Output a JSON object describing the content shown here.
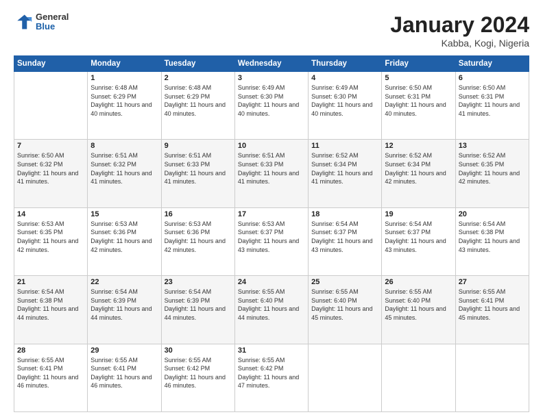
{
  "header": {
    "logo": {
      "general": "General",
      "blue": "Blue"
    },
    "title": "January 2024",
    "location": "Kabba, Kogi, Nigeria"
  },
  "calendar": {
    "headers": [
      "Sunday",
      "Monday",
      "Tuesday",
      "Wednesday",
      "Thursday",
      "Friday",
      "Saturday"
    ],
    "weeks": [
      [
        {
          "day": "",
          "sunrise": "",
          "sunset": "",
          "daylight": ""
        },
        {
          "day": "1",
          "sunrise": "Sunrise: 6:48 AM",
          "sunset": "Sunset: 6:29 PM",
          "daylight": "Daylight: 11 hours and 40 minutes."
        },
        {
          "day": "2",
          "sunrise": "Sunrise: 6:48 AM",
          "sunset": "Sunset: 6:29 PM",
          "daylight": "Daylight: 11 hours and 40 minutes."
        },
        {
          "day": "3",
          "sunrise": "Sunrise: 6:49 AM",
          "sunset": "Sunset: 6:30 PM",
          "daylight": "Daylight: 11 hours and 40 minutes."
        },
        {
          "day": "4",
          "sunrise": "Sunrise: 6:49 AM",
          "sunset": "Sunset: 6:30 PM",
          "daylight": "Daylight: 11 hours and 40 minutes."
        },
        {
          "day": "5",
          "sunrise": "Sunrise: 6:50 AM",
          "sunset": "Sunset: 6:31 PM",
          "daylight": "Daylight: 11 hours and 40 minutes."
        },
        {
          "day": "6",
          "sunrise": "Sunrise: 6:50 AM",
          "sunset": "Sunset: 6:31 PM",
          "daylight": "Daylight: 11 hours and 41 minutes."
        }
      ],
      [
        {
          "day": "7",
          "sunrise": "Sunrise: 6:50 AM",
          "sunset": "Sunset: 6:32 PM",
          "daylight": "Daylight: 11 hours and 41 minutes."
        },
        {
          "day": "8",
          "sunrise": "Sunrise: 6:51 AM",
          "sunset": "Sunset: 6:32 PM",
          "daylight": "Daylight: 11 hours and 41 minutes."
        },
        {
          "day": "9",
          "sunrise": "Sunrise: 6:51 AM",
          "sunset": "Sunset: 6:33 PM",
          "daylight": "Daylight: 11 hours and 41 minutes."
        },
        {
          "day": "10",
          "sunrise": "Sunrise: 6:51 AM",
          "sunset": "Sunset: 6:33 PM",
          "daylight": "Daylight: 11 hours and 41 minutes."
        },
        {
          "day": "11",
          "sunrise": "Sunrise: 6:52 AM",
          "sunset": "Sunset: 6:34 PM",
          "daylight": "Daylight: 11 hours and 41 minutes."
        },
        {
          "day": "12",
          "sunrise": "Sunrise: 6:52 AM",
          "sunset": "Sunset: 6:34 PM",
          "daylight": "Daylight: 11 hours and 42 minutes."
        },
        {
          "day": "13",
          "sunrise": "Sunrise: 6:52 AM",
          "sunset": "Sunset: 6:35 PM",
          "daylight": "Daylight: 11 hours and 42 minutes."
        }
      ],
      [
        {
          "day": "14",
          "sunrise": "Sunrise: 6:53 AM",
          "sunset": "Sunset: 6:35 PM",
          "daylight": "Daylight: 11 hours and 42 minutes."
        },
        {
          "day": "15",
          "sunrise": "Sunrise: 6:53 AM",
          "sunset": "Sunset: 6:36 PM",
          "daylight": "Daylight: 11 hours and 42 minutes."
        },
        {
          "day": "16",
          "sunrise": "Sunrise: 6:53 AM",
          "sunset": "Sunset: 6:36 PM",
          "daylight": "Daylight: 11 hours and 42 minutes."
        },
        {
          "day": "17",
          "sunrise": "Sunrise: 6:53 AM",
          "sunset": "Sunset: 6:37 PM",
          "daylight": "Daylight: 11 hours and 43 minutes."
        },
        {
          "day": "18",
          "sunrise": "Sunrise: 6:54 AM",
          "sunset": "Sunset: 6:37 PM",
          "daylight": "Daylight: 11 hours and 43 minutes."
        },
        {
          "day": "19",
          "sunrise": "Sunrise: 6:54 AM",
          "sunset": "Sunset: 6:37 PM",
          "daylight": "Daylight: 11 hours and 43 minutes."
        },
        {
          "day": "20",
          "sunrise": "Sunrise: 6:54 AM",
          "sunset": "Sunset: 6:38 PM",
          "daylight": "Daylight: 11 hours and 43 minutes."
        }
      ],
      [
        {
          "day": "21",
          "sunrise": "Sunrise: 6:54 AM",
          "sunset": "Sunset: 6:38 PM",
          "daylight": "Daylight: 11 hours and 44 minutes."
        },
        {
          "day": "22",
          "sunrise": "Sunrise: 6:54 AM",
          "sunset": "Sunset: 6:39 PM",
          "daylight": "Daylight: 11 hours and 44 minutes."
        },
        {
          "day": "23",
          "sunrise": "Sunrise: 6:54 AM",
          "sunset": "Sunset: 6:39 PM",
          "daylight": "Daylight: 11 hours and 44 minutes."
        },
        {
          "day": "24",
          "sunrise": "Sunrise: 6:55 AM",
          "sunset": "Sunset: 6:40 PM",
          "daylight": "Daylight: 11 hours and 44 minutes."
        },
        {
          "day": "25",
          "sunrise": "Sunrise: 6:55 AM",
          "sunset": "Sunset: 6:40 PM",
          "daylight": "Daylight: 11 hours and 45 minutes."
        },
        {
          "day": "26",
          "sunrise": "Sunrise: 6:55 AM",
          "sunset": "Sunset: 6:40 PM",
          "daylight": "Daylight: 11 hours and 45 minutes."
        },
        {
          "day": "27",
          "sunrise": "Sunrise: 6:55 AM",
          "sunset": "Sunset: 6:41 PM",
          "daylight": "Daylight: 11 hours and 45 minutes."
        }
      ],
      [
        {
          "day": "28",
          "sunrise": "Sunrise: 6:55 AM",
          "sunset": "Sunset: 6:41 PM",
          "daylight": "Daylight: 11 hours and 46 minutes."
        },
        {
          "day": "29",
          "sunrise": "Sunrise: 6:55 AM",
          "sunset": "Sunset: 6:41 PM",
          "daylight": "Daylight: 11 hours and 46 minutes."
        },
        {
          "day": "30",
          "sunrise": "Sunrise: 6:55 AM",
          "sunset": "Sunset: 6:42 PM",
          "daylight": "Daylight: 11 hours and 46 minutes."
        },
        {
          "day": "31",
          "sunrise": "Sunrise: 6:55 AM",
          "sunset": "Sunset: 6:42 PM",
          "daylight": "Daylight: 11 hours and 47 minutes."
        },
        {
          "day": "",
          "sunrise": "",
          "sunset": "",
          "daylight": ""
        },
        {
          "day": "",
          "sunrise": "",
          "sunset": "",
          "daylight": ""
        },
        {
          "day": "",
          "sunrise": "",
          "sunset": "",
          "daylight": ""
        }
      ]
    ]
  }
}
